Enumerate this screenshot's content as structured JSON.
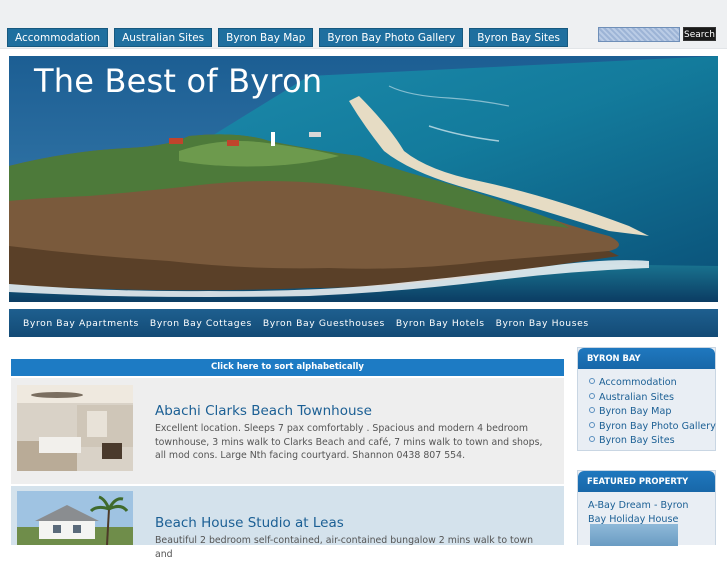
{
  "top_nav": {
    "items": [
      "Accommodation",
      "Australian Sites",
      "Byron Bay Map",
      "Byron Bay Photo Gallery",
      "Byron Bay Sites"
    ]
  },
  "search": {
    "button_label": "Search"
  },
  "header": {
    "site_title": "The Best of Byron"
  },
  "sub_nav": {
    "items": [
      "Byron Bay Apartments",
      "Byron Bay Cottages",
      "Byron Bay Guesthouses",
      "Byron Bay Hotels",
      "Byron Bay Houses"
    ]
  },
  "main": {
    "sort_label": "Click here to sort alphabetically",
    "listings": [
      {
        "title": "Abachi Clarks Beach Townhouse",
        "description": "Excellent location. Sleeps 7 pax comfortably . Spacious and modern 4 bedroom townhouse, 3 mins walk to Clarks Beach and café, 7 mins walk to town and shops, all mod cons. Large Nth facing courtyard. Shannon 0438 807 554."
      },
      {
        "title": "Beach House Studio at Leas",
        "description": "Beautiful 2 bedroom self-contained, air-contained bungalow 2 mins walk to town and"
      }
    ]
  },
  "sidebar": {
    "byron_bay": {
      "heading": "BYRON BAY",
      "items": [
        "Accommodation",
        "Australian Sites",
        "Byron Bay Map",
        "Byron Bay Photo Gallery",
        "Byron Bay Sites"
      ]
    },
    "featured": {
      "heading": "FEATURED PROPERTY",
      "link": "A-Bay Dream - Byron Bay Holiday House"
    }
  },
  "colors": {
    "nav_blue": "#1f6f9f",
    "sort_bar": "#1d7bc4",
    "link_blue": "#1b5f94"
  }
}
